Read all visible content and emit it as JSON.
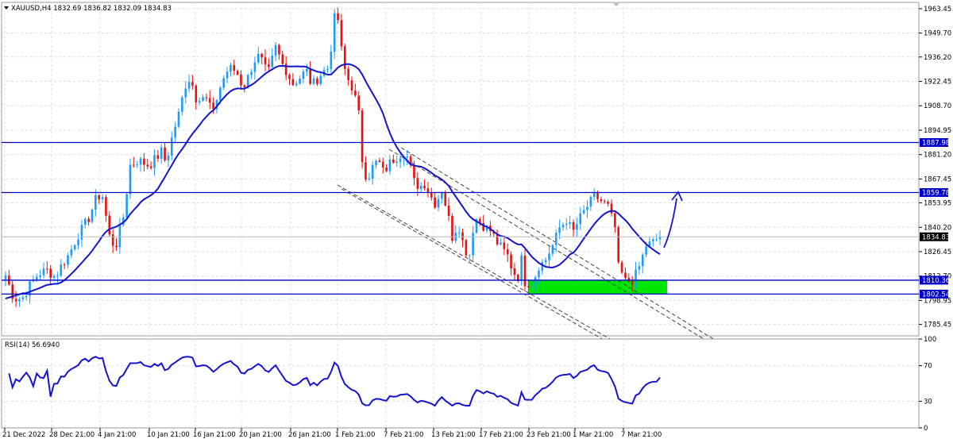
{
  "symbol_header": "XAUUSD,H4  1832.69 1836.82 1832.09 1834.83",
  "indicator_header": "RSI(14) 56.6940",
  "colors": {
    "bull": "#1e9bff",
    "bear": "#e81010",
    "ma": "#1414d2",
    "hline": "#0000c8",
    "zone": "#00e600",
    "rsi": "#1414d2",
    "grid": "#dcdcdc"
  },
  "price_axis": {
    "range": [
      1779.0,
      1967.0
    ],
    "ticks": [
      "1963.45",
      "1949.70",
      "1936.20",
      "1922.45",
      "1908.70",
      "1894.95",
      "1881.20",
      "1867.45",
      "1853.95",
      "1840.20",
      "1826.45",
      "1812.70",
      "1798.95",
      "1785.45"
    ]
  },
  "rsi_axis": {
    "ticks": [
      "100",
      "70",
      "30",
      "0"
    ]
  },
  "time_axis": {
    "ticks": [
      "21 Dec 2022",
      "28 Dec 21:00",
      "4 Jan 21:00",
      "10 Jan 21:00",
      "16 Jan 21:00",
      "20 Jan 21:00",
      "26 Jan 21:00",
      "1 Feb 21:00",
      "7 Feb 21:00",
      "13 Feb 21:00",
      "17 Feb 21:00",
      "23 Feb 21:00",
      "1 Mar 21:00",
      "7 Mar 21:00"
    ]
  },
  "horizontal_levels": [
    {
      "price": 1887.98,
      "label": "1887.98"
    },
    {
      "price": 1859.78,
      "label": "1859.78"
    },
    {
      "price": 1810.36,
      "label": "1810.36"
    },
    {
      "price": 1802.54,
      "label": "1802.54"
    }
  ],
  "current_price": {
    "price": 1834.83,
    "label": "1834.83"
  },
  "support_zone": {
    "from": 1802.54,
    "to": 1810.36
  }
}
